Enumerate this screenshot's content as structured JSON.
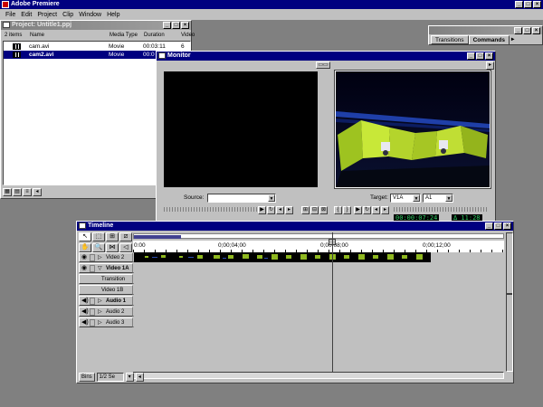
{
  "app": {
    "title": "Adobe Premiere"
  },
  "menu": [
    "File",
    "Edit",
    "Project",
    "Clip",
    "Window",
    "Help"
  ],
  "project": {
    "title": "Project: Untitle1.ppj",
    "item_count": "2 items",
    "columns": [
      "Name",
      "Media Type",
      "Duration",
      "Video"
    ],
    "rows": [
      {
        "name": "cam.avi",
        "type": "Movie",
        "duration": "00:03:11",
        "video": "6"
      },
      {
        "name": "cam2.avi",
        "type": "Movie",
        "duration": "00:0",
        "video": ""
      }
    ]
  },
  "commands": {
    "tabs": [
      "Transitions",
      "Commands"
    ]
  },
  "monitor": {
    "title": "Monitor",
    "source_label": "Source:",
    "target_label": "Target:",
    "target_video": "V1A",
    "target_audio": "A1",
    "program_timecode": "00:00:07:24",
    "program_duration": "Δ 11:28"
  },
  "timeline": {
    "title": "Timeline",
    "ruler_labels": [
      "0:00",
      "0;00;04;00",
      "0;00;08;00",
      "0;00;12;00"
    ],
    "tracks": [
      {
        "name": "Video 2",
        "expand": "▷",
        "bold": false
      },
      {
        "name": "Video 1A",
        "expand": "▽",
        "bold": true
      },
      {
        "name": "Transition",
        "expand": "",
        "bold": false
      },
      {
        "name": "Video 1B",
        "expand": "",
        "bold": false
      },
      {
        "name": "Audio 1",
        "expand": "▷",
        "bold": true
      },
      {
        "name": "Audio 2",
        "expand": "▷",
        "bold": false
      },
      {
        "name": "Audio 3",
        "expand": "▷",
        "bold": false
      }
    ],
    "bins_label": "Bins",
    "zoom_label": "1/2 Se"
  }
}
